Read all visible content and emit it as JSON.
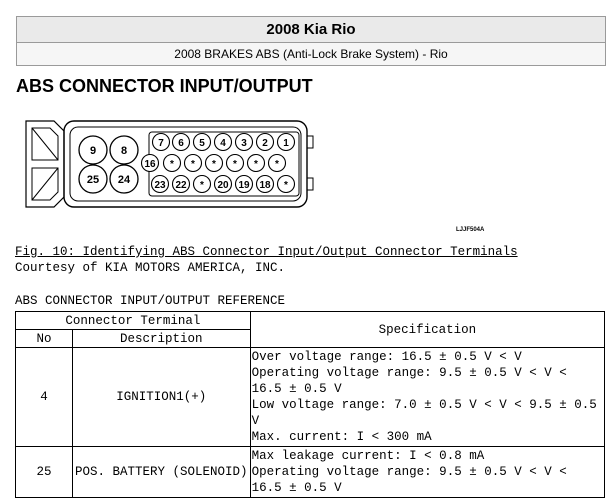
{
  "header": {
    "title": "2008 Kia Rio",
    "subtitle": "2008 BRAKES ABS (Anti-Lock Brake System) - Rio"
  },
  "section_title": "ABS CONNECTOR INPUT/OUTPUT",
  "diagram": {
    "figure_code": "LJJF504A",
    "large_pins": [
      "9",
      "8",
      "25",
      "24"
    ],
    "top_row": [
      "7",
      "6",
      "5",
      "4",
      "3",
      "2",
      "1"
    ],
    "middle_row": [
      "16",
      "*",
      "*",
      "*",
      "*",
      "*",
      "*"
    ],
    "bottom_row": [
      "23",
      "22",
      "*",
      "20",
      "19",
      "18",
      "*"
    ]
  },
  "figure": {
    "caption": "Fig. 10: Identifying ABS Connector Input/Output Connector Terminals",
    "courtesy": "Courtesy of KIA MOTORS AMERICA, INC."
  },
  "table": {
    "title": "ABS CONNECTOR INPUT/OUTPUT REFERENCE",
    "group_header": "Connector Terminal",
    "col_no": "No",
    "col_desc": "Description",
    "col_spec": "Specification",
    "rows": [
      {
        "no": "4",
        "desc": "IGNITION1(+)",
        "spec": [
          "Over voltage range: 16.5 ± 0.5 V < V",
          "Operating voltage range: 9.5 ± 0.5 V < V < 16.5 ± 0.5 V",
          "Low voltage range: 7.0 ± 0.5 V < V < 9.5 ± 0.5 V",
          "Max. current: I < 300 mA"
        ]
      },
      {
        "no": "25",
        "desc": "POS. BATTERY (SOLENOID)",
        "spec": [
          "Max leakage current: I < 0.8 mA",
          "Operating voltage range: 9.5 ± 0.5 V < V < 16.5 ± 0.5 V"
        ]
      }
    ]
  }
}
